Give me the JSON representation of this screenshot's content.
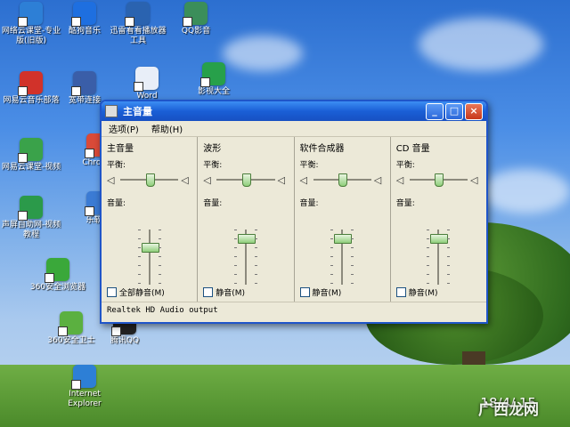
{
  "desktop": {
    "icons": [
      {
        "label": "网络云课堂-专业版(旧版)",
        "icon": "cloud-class-icon",
        "color": "#2d7fd6"
      },
      {
        "label": "酷狗音乐",
        "icon": "kugou-music-icon",
        "color": "#1e6fe0"
      },
      {
        "label": "迅雷看看播放器工具",
        "icon": "xunlei-player-icon",
        "color": "#2a63b0"
      },
      {
        "label": "QQ影音",
        "icon": "qq-player-icon",
        "color": "#3b8e5a"
      },
      {
        "label": "网易云音乐部落",
        "icon": "netease-music-icon",
        "color": "#d1322a"
      },
      {
        "label": "宽带连接",
        "icon": "broadband-icon",
        "color": "#3a5ea8"
      },
      {
        "label": "Word",
        "icon": "word-doc-icon",
        "color": "#e8eef8"
      },
      {
        "label": "影视大全",
        "icon": "video-app-icon",
        "color": "#27a04a"
      },
      {
        "label": "网易云课堂-视频",
        "icon": "video-course-icon",
        "color": "#3aa24a"
      },
      {
        "label": "Chrome",
        "icon": "chrome-icon",
        "color": "#d94a38"
      },
      {
        "label": "声屏自助网-视频教程",
        "icon": "tutorial-icon",
        "color": "#2b9a4a"
      },
      {
        "label": "乐软件",
        "icon": "software-icon",
        "color": "#3b7bd4"
      },
      {
        "label": "360安全浏览器",
        "icon": "browser-icon",
        "color": "#3aa83a"
      },
      {
        "label": "360安全卫士",
        "icon": "security-icon",
        "color": "#5bb040"
      },
      {
        "label": "腾讯QQ",
        "icon": "qq-icon",
        "color": "#222222"
      },
      {
        "label": "Internet Explorer",
        "icon": "ie-icon",
        "color": "#2d7fd6"
      }
    ]
  },
  "window": {
    "title": "主音量",
    "buttons": {
      "minimize": "_",
      "maximize": "□",
      "close": "×"
    },
    "menu": [
      "选项(P)",
      "帮助(H)"
    ],
    "panels": [
      {
        "title": "主音量",
        "balance_label": "平衡:",
        "balance": 0.5,
        "volume_label": "音量:",
        "volume": 0.7,
        "mute_label": "全部静音(M)",
        "muted": false
      },
      {
        "title": "波形",
        "balance_label": "平衡:",
        "balance": 0.5,
        "volume_label": "音量:",
        "volume": 0.85,
        "mute_label": "静音(M)",
        "muted": false
      },
      {
        "title": "软件合成器",
        "balance_label": "平衡:",
        "balance": 0.5,
        "volume_label": "音量:",
        "volume": 0.85,
        "mute_label": "静音(M)",
        "muted": false
      },
      {
        "title": "CD 音量",
        "balance_label": "平衡:",
        "balance": 0.5,
        "volume_label": "音量:",
        "volume": 0.85,
        "mute_label": "静音(M)",
        "muted": false
      }
    ],
    "status": "Realtek HD Audio output"
  },
  "clock": "18/4/ 15",
  "watermark": "广西龙网"
}
